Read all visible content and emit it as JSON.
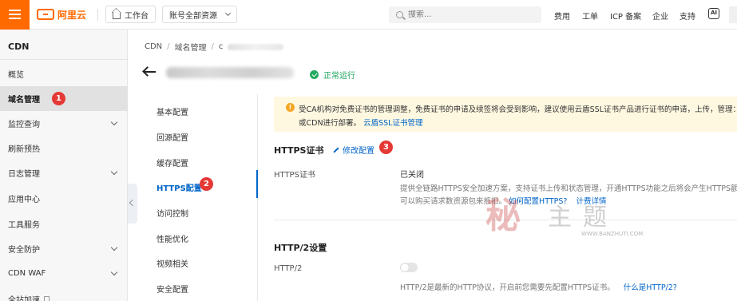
{
  "topbar": {
    "logo_text": "阿里云",
    "workbench_label": "工作台",
    "resource_label": "账号全部资源",
    "search_placeholder": "搜索...",
    "nav": [
      "费用",
      "工单",
      "ICP 备案",
      "企业",
      "支持"
    ],
    "ai_icon_text": "AI"
  },
  "sidebar": {
    "title": "CDN",
    "items": [
      {
        "label": "概览"
      },
      {
        "label": "域名管理"
      },
      {
        "label": "监控查询"
      },
      {
        "label": "刷新预热"
      },
      {
        "label": "日志管理"
      },
      {
        "label": "应用中心"
      },
      {
        "label": "工具服务"
      },
      {
        "label": "安全防护"
      },
      {
        "label": "CDN WAF"
      },
      {
        "label": "全站加速"
      }
    ]
  },
  "breadcrumb": {
    "root": "CDN",
    "level2": "域名管理",
    "level3": "c"
  },
  "status_text": "正常运行",
  "config_nav": [
    "基本配置",
    "回源配置",
    "缓存配置",
    "HTTPS配置",
    "访问控制",
    "性能优化",
    "视频相关",
    "安全配置"
  ],
  "notice": {
    "line1": "受CA机构对免费证书的管理调整，免费证书的申请及续签将会受到影响，建议使用云盾SSL证书产品进行证书的申请，上传，管理：",
    "line2_prefix": "或CDN进行部署。",
    "line2_link": "云盾SSL证书管理"
  },
  "https_section": {
    "title": "HTTPS证书",
    "edit_label": "修改配置",
    "field_label": "HTTPS证书",
    "field_value": "已关闭",
    "desc_line1": "提供全链路HTTPS安全加速方案，支持证书上传和状态管理，开通HTTPS功能之后将会产生HTTPS额",
    "desc_line2_prefix": "可以购买请求数资源包来抵扣。",
    "link1": "如何配置HTTPS?",
    "link2": "计费详情"
  },
  "http2_section": {
    "title": "HTTP/2设置",
    "field_label": "HTTP/2",
    "toggle_on": false,
    "desc_prefix": "HTTP/2是最新的HTTP协议，开启前您需要先配置HTTPS证书。",
    "link": "什么是HTTP/2?"
  },
  "badges": [
    "1",
    "2",
    "3"
  ],
  "watermark": {
    "seal": "秘",
    "text": "主题",
    "url": "WWW.BANZHUTI.COM"
  },
  "colors": {
    "brand": "#ff6a00",
    "link": "#0064c8",
    "success": "#1aa35a",
    "badge": "#e53935",
    "notice_bg": "#fff8e1"
  }
}
